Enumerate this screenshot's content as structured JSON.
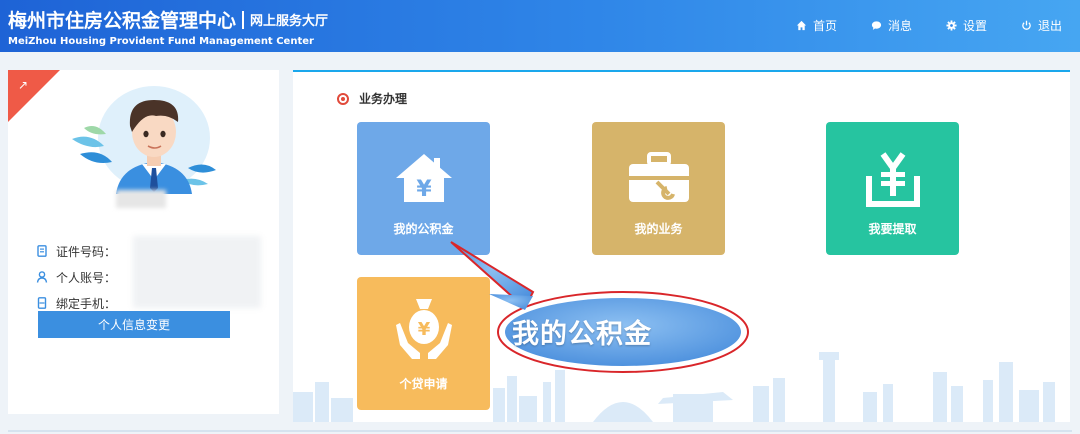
{
  "header": {
    "title": "梅州市住房公积金管理中心",
    "subtitle": "网上服务大厅",
    "title_en": "MeiZhou Housing Provident Fund Management Center",
    "nav": [
      {
        "label": "首页",
        "icon": "home-icon"
      },
      {
        "label": "消息",
        "icon": "message-icon"
      },
      {
        "label": "设置",
        "icon": "gear-icon"
      },
      {
        "label": "退出",
        "icon": "power-icon"
      }
    ]
  },
  "profile": {
    "fields": [
      {
        "label": "证件号码：",
        "icon": "id-document-icon"
      },
      {
        "label": "个人账号：",
        "icon": "user-icon"
      },
      {
        "label": "绑定手机：",
        "icon": "phone-icon"
      }
    ],
    "edit_button": "个人信息变更"
  },
  "business": {
    "section_title": "业务办理",
    "tiles": [
      {
        "label": "我的公积金",
        "icon": "house-yuan-icon",
        "color": "#6ea8e8"
      },
      {
        "label": "我的业务",
        "icon": "toolbox-icon",
        "color": "#d6b46a"
      },
      {
        "label": "我要提取",
        "icon": "withdraw-yuan-icon",
        "color": "#26c4a0"
      },
      {
        "label": "个贷申请",
        "icon": "money-bag-hands-icon",
        "color": "#f7bb5c"
      }
    ],
    "callout": "我的公积金"
  },
  "colors": {
    "header_start": "#1e63d6",
    "header_end": "#46a6f2",
    "accent_blue": "#3b8fe0",
    "corner_red": "#ef5a47",
    "callout_border": "#d9262a"
  }
}
